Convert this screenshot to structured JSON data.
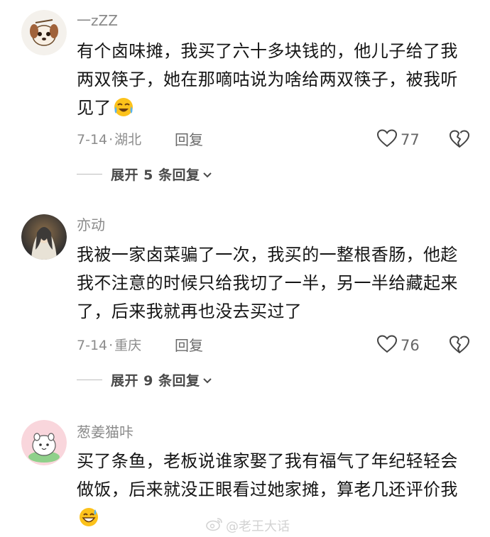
{
  "comments": [
    {
      "username": "一zZZ",
      "text": "有个卤味摊，我买了六十多块钱的，他儿子给了我两双筷子，她在那嘀咕说为啥给两双筷子，被我听见了",
      "emoji": "crying-laughing-emoji",
      "date": "7-14",
      "separator": "·",
      "location": "湖北",
      "reply_label": "回复",
      "likes": "77",
      "expand_label": "展开 5 条回复"
    },
    {
      "username": "亦动",
      "text": "我被一家卤菜骗了一次，我买的一整根香肠，他趁我不注意的时候只给我切了一半，另一半给藏起来了，后来我就再也没去买过了",
      "date": "7-14",
      "separator": "·",
      "location": "重庆",
      "reply_label": "回复",
      "likes": "76",
      "expand_label": "展开 9 条回复"
    },
    {
      "username": "葱姜猫咔",
      "text": "买了条鱼，老板说谁家娶了我有福气了年纪轻轻会做饭，后来就没正眼看过她家摊，算老几还评价我",
      "emoji": "grinning-sweat-emoji"
    }
  ],
  "watermark": {
    "text": "@老王大话",
    "icon": "weibo-logo-icon"
  },
  "colors": {
    "username": "#8a8a8a",
    "body": "#151515",
    "meta": "#8c8c8c"
  }
}
